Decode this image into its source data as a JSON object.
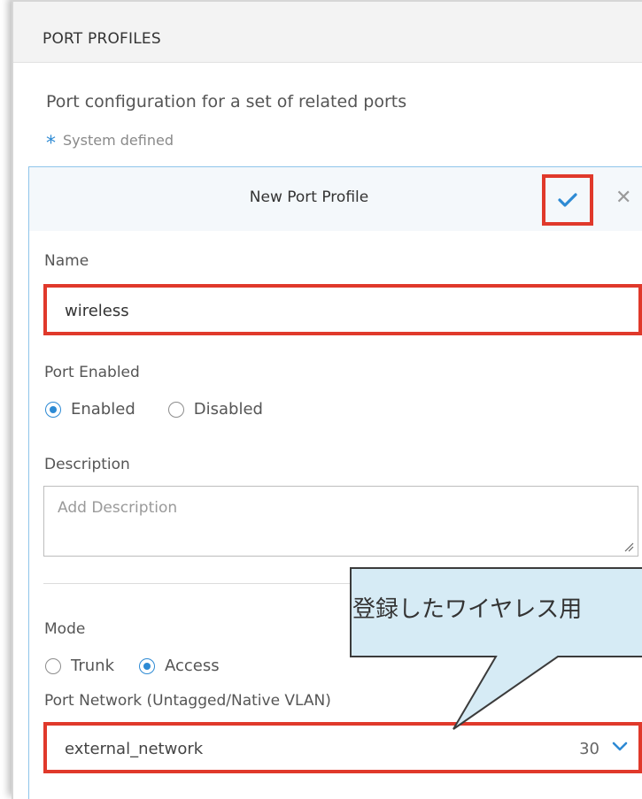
{
  "panel": {
    "title": "PORT PROFILES",
    "description": "Port configuration for a set of related ports",
    "system_defined": "System defined"
  },
  "form": {
    "title": "New Port Profile",
    "save_icon": "check-icon",
    "close_icon": "close-icon",
    "name_label": "Name",
    "name_value": "wireless",
    "port_enabled_label": "Port Enabled",
    "enabled_label": "Enabled",
    "disabled_label": "Disabled",
    "port_enabled_value": "Enabled",
    "description_label": "Description",
    "description_placeholder": "Add Description",
    "mode_label": "Mode",
    "trunk_label": "Trunk",
    "access_label": "Access",
    "mode_value": "Access",
    "port_network_label": "Port Network (Untagged/Native VLAN)",
    "port_network_value": "external_network",
    "port_network_vlan": "30"
  },
  "callout": {
    "text": "登録したワイヤレス用"
  },
  "colors": {
    "accent": "#2d8ad4",
    "highlight": "#e0392b",
    "callout_fill": "#d6ebf5",
    "callout_stroke": "#3b3b3b"
  }
}
